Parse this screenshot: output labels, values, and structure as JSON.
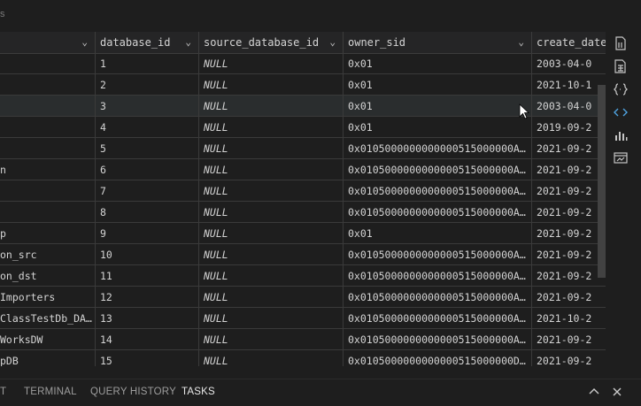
{
  "grid": {
    "columns": [
      {
        "label": ""
      },
      {
        "label": "database_id"
      },
      {
        "label": "source_database_id"
      },
      {
        "label": "owner_sid"
      },
      {
        "label": "create_date"
      }
    ],
    "rows": [
      {
        "name": "",
        "id": "1",
        "src": "NULL",
        "owner": "0x01",
        "date": "2003-04-0"
      },
      {
        "name": "",
        "id": "2",
        "src": "NULL",
        "owner": "0x01",
        "date": "2021-10-1"
      },
      {
        "name": "",
        "id": "3",
        "src": "NULL",
        "owner": "0x01",
        "date": "2003-04-0"
      },
      {
        "name": "",
        "id": "4",
        "src": "NULL",
        "owner": "0x01",
        "date": "2019-09-2"
      },
      {
        "name": "",
        "id": "5",
        "src": "NULL",
        "owner": "0x0105000000000000515000000A0…",
        "date": "2021-09-2"
      },
      {
        "name": "n",
        "id": "6",
        "src": "NULL",
        "owner": "0x0105000000000000515000000A0…",
        "date": "2021-09-2"
      },
      {
        "name": "",
        "id": "7",
        "src": "NULL",
        "owner": "0x0105000000000000515000000A0…",
        "date": "2021-09-2"
      },
      {
        "name": "",
        "id": "8",
        "src": "NULL",
        "owner": "0x0105000000000000515000000A0…",
        "date": "2021-09-2"
      },
      {
        "name": "p",
        "id": "9",
        "src": "NULL",
        "owner": "0x01",
        "date": "2021-09-2"
      },
      {
        "name": "on_src",
        "id": "10",
        "src": "NULL",
        "owner": "0x0105000000000000515000000A0…",
        "date": "2021-09-2"
      },
      {
        "name": "on_dst",
        "id": "11",
        "src": "NULL",
        "owner": "0x0105000000000000515000000A0…",
        "date": "2021-09-2"
      },
      {
        "name": "Importers",
        "id": "12",
        "src": "NULL",
        "owner": "0x0105000000000000515000000A0…",
        "date": "2021-09-2"
      },
      {
        "name": "ClassTestDb_DA…",
        "id": "13",
        "src": "NULL",
        "owner": "0x0105000000000000515000000A0…",
        "date": "2021-10-2"
      },
      {
        "name": "WorksDW",
        "id": "14",
        "src": "NULL",
        "owner": "0x0105000000000000515000000A0…",
        "date": "2021-09-2"
      },
      {
        "name": "pDB",
        "id": "15",
        "src": "NULL",
        "owner": "0x0105000000000000515000000D…",
        "date": "2021-09-2"
      }
    ]
  },
  "toolbar_icons": [
    "save-as-csv-icon",
    "save-as-excel-icon",
    "save-as-json-icon",
    "save-as-xml-icon",
    "chart-icon",
    "visualize-icon"
  ],
  "panel": {
    "tabs": [
      "T",
      "TERMINAL",
      "QUERY HISTORY",
      "TASKS"
    ],
    "active_tab": "TASKS"
  },
  "colors": {
    "background": "#1e1e1e",
    "header": "#252526",
    "highlight_row": "#2a2d2e",
    "grid_line": "#3a3a3a"
  }
}
